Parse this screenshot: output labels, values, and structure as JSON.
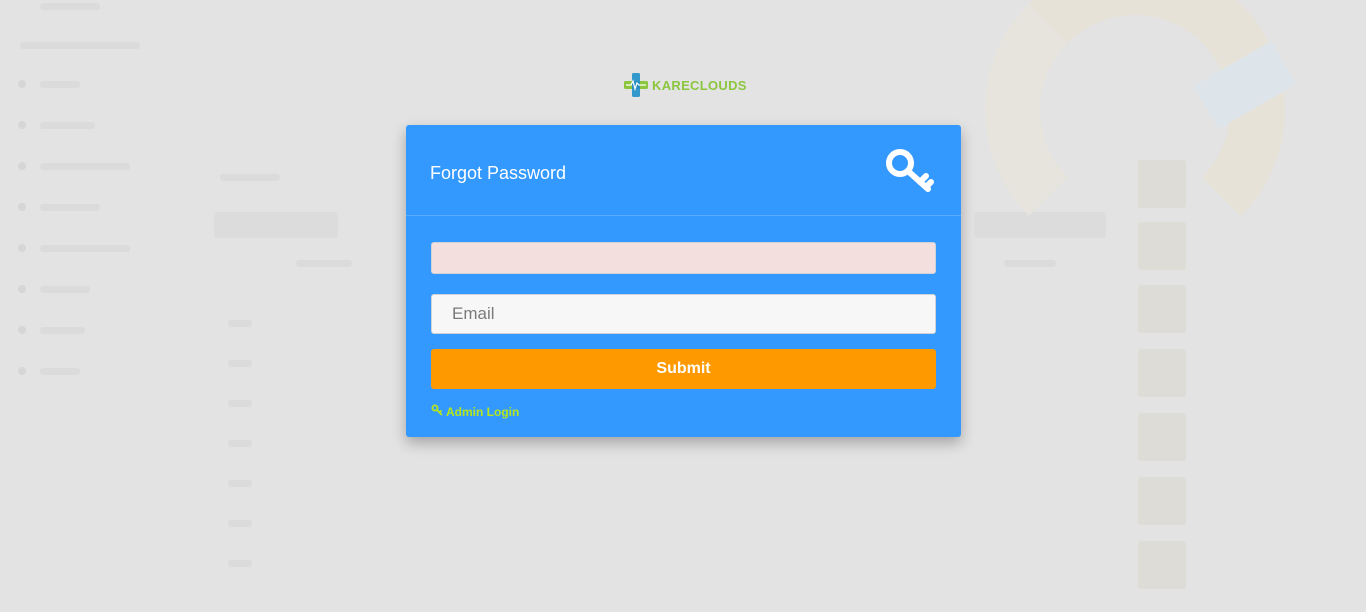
{
  "brand": {
    "name": "KARECLOUDS",
    "accent": "#8cc63f",
    "cross_color_a": "#3399cc",
    "cross_color_b": "#8cc63f"
  },
  "modal": {
    "title": "Forgot Password",
    "icon": "key-icon",
    "alert_value": "",
    "email_placeholder": "Email",
    "email_value": "",
    "submit_label": "Submit",
    "admin_link_label": "Admin Login",
    "admin_link_icon": "key-icon"
  },
  "colors": {
    "card": "#3399ff",
    "submit": "#ff9900",
    "link": "#b5e61d",
    "backdrop": "#e3e3e3"
  }
}
